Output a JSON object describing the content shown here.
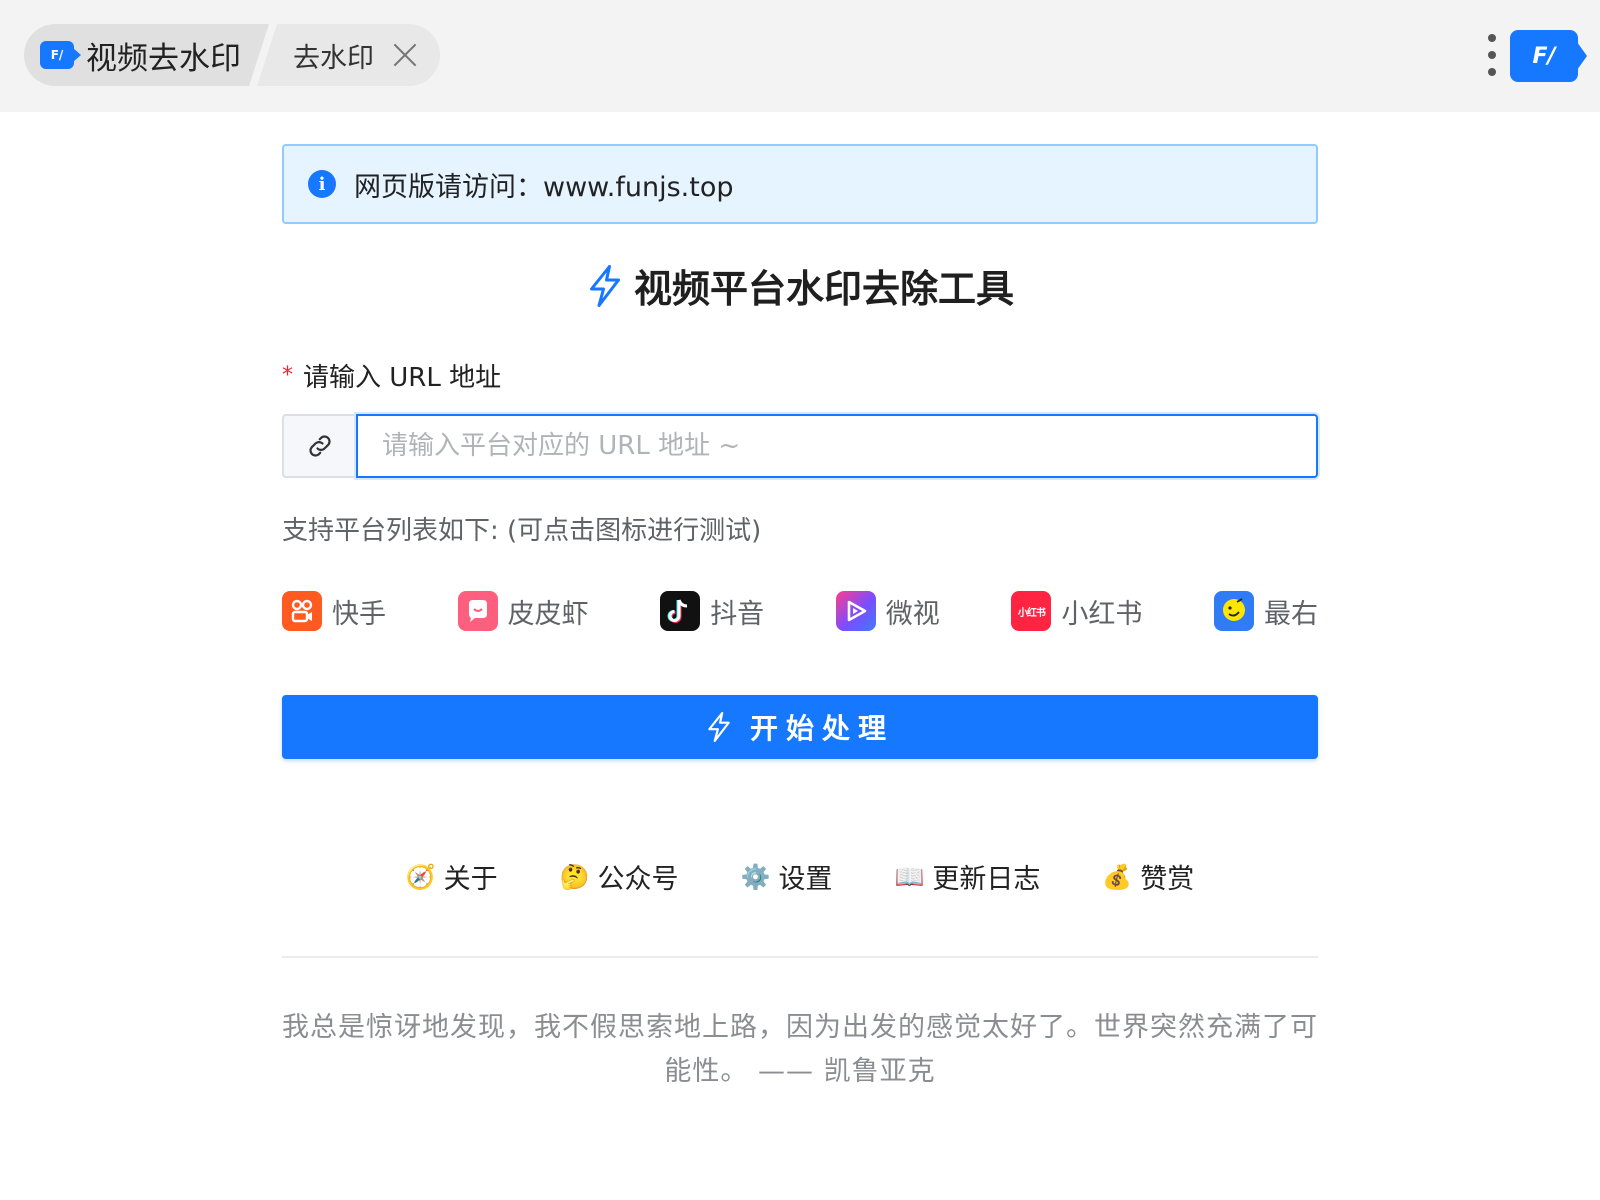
{
  "tabs": {
    "main_label": "视频去水印",
    "main_icon_text": "F/",
    "sub_label": "去水印"
  },
  "corner_app": {
    "icon_text": "F/"
  },
  "notice": {
    "text": "网页版请访问：www.funjs.top"
  },
  "heading": {
    "title": "视频平台水印去除工具"
  },
  "form": {
    "required_mark": "*",
    "label": "请输入 URL 地址",
    "url_value": "",
    "url_placeholder": "请输入平台对应的 URL 地址 ~"
  },
  "support": {
    "hint": "支持平台列表如下: (可点击图标进行测试)"
  },
  "platforms": [
    {
      "name": "快手",
      "color": "#ff5a1f",
      "icon": "kuaishou-logo"
    },
    {
      "name": "皮皮虾",
      "color": "#ff5f7e",
      "icon": "pipixia-logo"
    },
    {
      "name": "抖音",
      "color": "#111111",
      "icon": "douyin-logo"
    },
    {
      "name": "微视",
      "color": "#7b4dff",
      "icon": "weishi-logo"
    },
    {
      "name": "小红书",
      "color": "#ff2442",
      "icon": "xiaohongshu-logo",
      "logo_text": "小红书"
    },
    {
      "name": "最右",
      "color": "#2f7cf6",
      "icon": "zuiyou-logo"
    }
  ],
  "start_button": {
    "label": "开始处理"
  },
  "footer_links": [
    {
      "emoji": "🧭",
      "label": "关于"
    },
    {
      "emoji": "🤔",
      "label": "公众号"
    },
    {
      "emoji": "⚙️",
      "label": "设置"
    },
    {
      "emoji": "📖",
      "label": "更新日志"
    },
    {
      "emoji": "💰",
      "label": "赞赏"
    }
  ],
  "quote": {
    "line1": "我总是惊讶地发现，我不假思索地上路，因为出发的感觉太好了。世界突然充满了可",
    "line2": "能性。 —— 凯鲁亚克"
  },
  "colors": {
    "accent": "#1677ff",
    "notice_bg": "#e6f4ff",
    "notice_border": "#91caff",
    "required": "#f5222d"
  }
}
